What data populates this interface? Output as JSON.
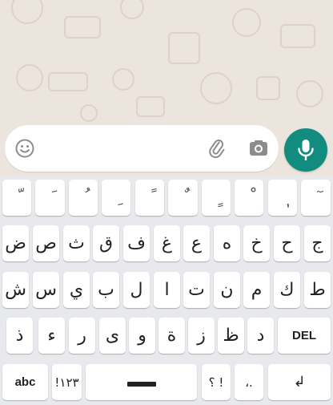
{
  "composer": {
    "placeholder": "",
    "icons": {
      "emoji": "emoji-icon",
      "attach": "paperclip-icon",
      "camera": "camera-icon",
      "mic": "microphone-icon"
    }
  },
  "colors": {
    "accent": "#128c7e",
    "chat_bg": "#ece5dd",
    "keyboard_bg": "#e8e9ec",
    "key_bg": "#ffffff"
  },
  "keyboard": {
    "row1": [
      "ّ",
      "َ",
      "ُ",
      "ِ",
      "ً",
      "ٌ",
      "ٍ",
      "ْ",
      "ٖ",
      "ٓ"
    ],
    "row2": [
      "ض",
      "ص",
      "ث",
      "ق",
      "ف",
      "غ",
      "ع",
      "ه",
      "خ",
      "ح",
      "ج"
    ],
    "row3": [
      "ش",
      "س",
      "ي",
      "ب",
      "ل",
      "ا",
      "ت",
      "ن",
      "م",
      "ك",
      "ط"
    ],
    "row4": [
      "ذ",
      "ء",
      "ر",
      "ى",
      "و",
      "ة",
      "ز",
      "ظ",
      "د"
    ],
    "del_label": "DEL",
    "abc_label": "abc",
    "numbers_label": "!١٢٣",
    "punct1_label": "؟ !",
    "punct2_label": "،.",
    "enter_label": "↲"
  }
}
